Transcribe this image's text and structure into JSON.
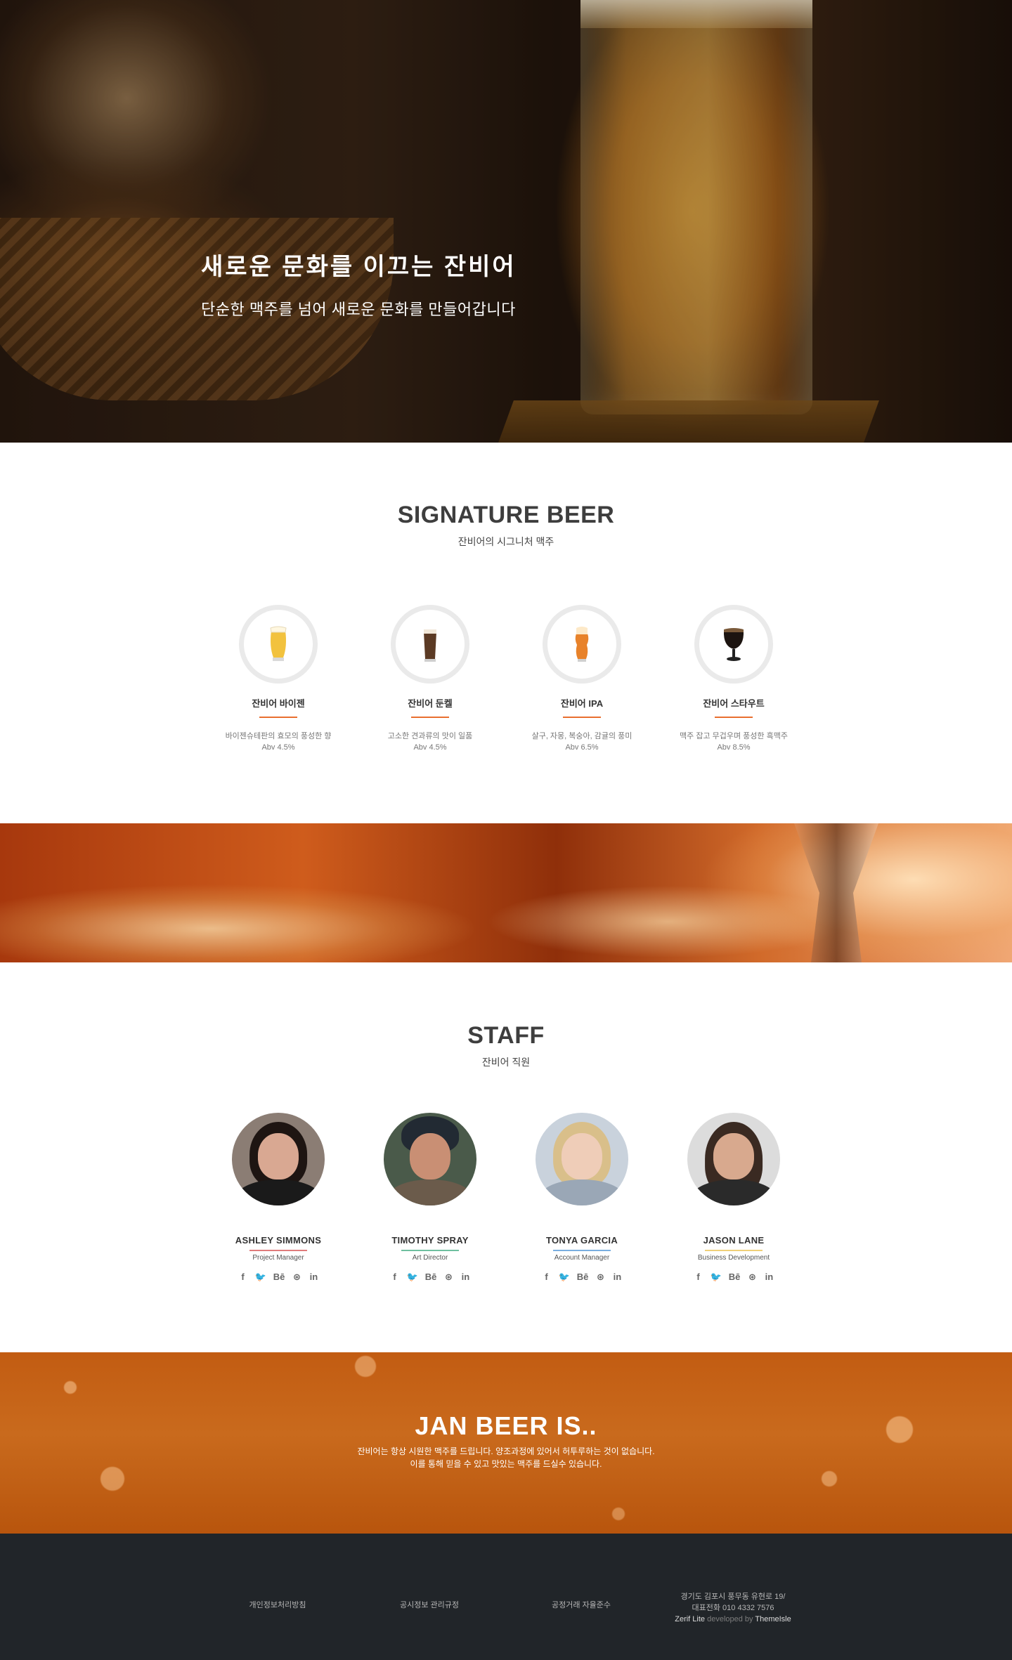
{
  "hero": {
    "title": "새로운 문화를 이끄는 잔비어",
    "subtitle": "단순한 맥주를 넘어 새로운 문화를 만들어갑니다"
  },
  "signature": {
    "title": "SIGNATURE BEER",
    "subtitle": "잔비어의 시그니처 맥주",
    "beers": [
      {
        "name": "잔비어 바이젠",
        "desc": "바이젠슈테판의 효모의 풍성한 향",
        "abv": "Abv 4.5%",
        "icon": "wheat-beer-glass-icon",
        "color": "#f2c23e"
      },
      {
        "name": "잔비어 둔켈",
        "desc": "고소한 견과류의 맛이 일품",
        "abv": "Abv 4.5%",
        "icon": "dark-lager-glass-icon",
        "color": "#5b3a24"
      },
      {
        "name": "잔비어 IPA",
        "desc": "살구, 자몽, 복숭아, 감귤의 풍미",
        "abv": "Abv 6.5%",
        "icon": "ipa-glass-icon",
        "color": "#e8822a"
      },
      {
        "name": "잔비어 스타우트",
        "desc": "맥주 잡고 무겁우며 풍성한 흑맥주",
        "abv": "Abv 8.5%",
        "icon": "stout-glass-icon",
        "color": "#1c1410"
      }
    ]
  },
  "staff": {
    "title": "STAFF",
    "subtitle": "잔비어 직원",
    "members": [
      {
        "name": "ASHLEY SIMMONS",
        "role": "Project Manager",
        "accent": "#e07b7b"
      },
      {
        "name": "TIMOTHY SPRAY",
        "role": "Art Director",
        "accent": "#6fc0a0"
      },
      {
        "name": "TONYA GARCIA",
        "role": "Account Manager",
        "accent": "#79aee0"
      },
      {
        "name": "JASON LANE",
        "role": "Business Development",
        "accent": "#f0d078"
      }
    ],
    "social_icons": [
      "facebook-icon",
      "twitter-icon",
      "behance-icon",
      "dribbble-icon",
      "linkedin-icon"
    ],
    "social_glyphs": [
      "f",
      "🐦",
      "Bē",
      "⊛",
      "in"
    ]
  },
  "about": {
    "title": "JAN BEER IS..",
    "line1": "잔비어는 항상 시원한 맥주를 드립니다. 양조과정에 있어서 허투루하는 것이 없습니다.",
    "line2": "이를 통해 믿을 수 있고 맛있는 맥주를 드실수 있습니다."
  },
  "footer": {
    "links": [
      "개인정보처리방침",
      "공시정보 관리규정",
      "공정거래 자율준수"
    ],
    "address": "경기도 김포시 풍무동 유현로 19/",
    "phone": "대표전화 010 4332 7576",
    "credit_brand": "Zerif Lite",
    "credit_mid": " developed by ",
    "credit_author": "ThemeIsle"
  },
  "colors": {
    "accent": "#e96f2f",
    "footer_bg": "#212529"
  }
}
